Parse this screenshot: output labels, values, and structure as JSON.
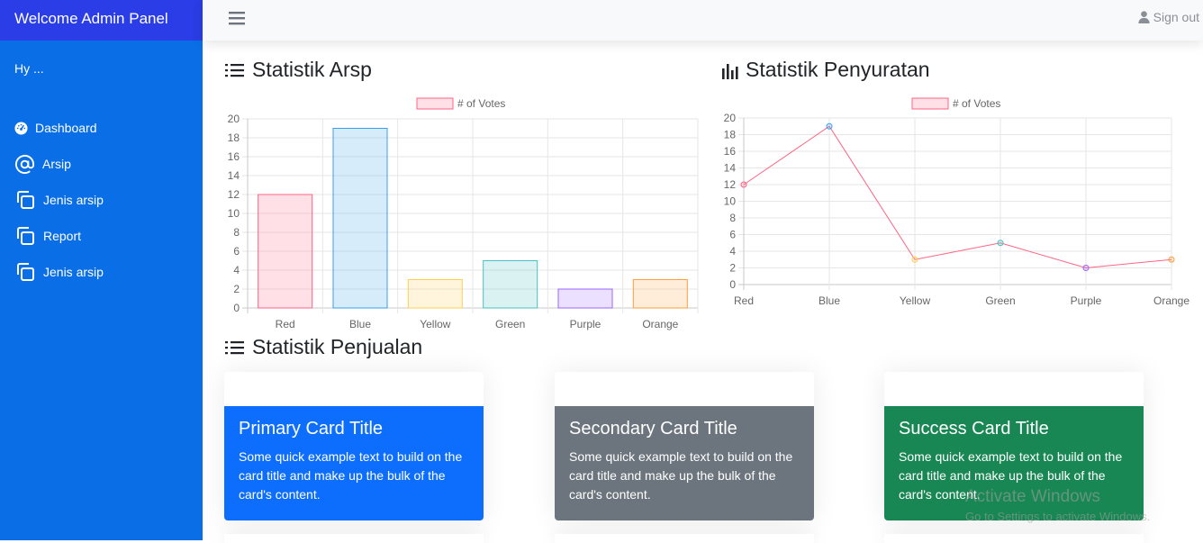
{
  "sidebar": {
    "brand": "Welcome Admin Panel",
    "greeting": "Hy ...",
    "items": [
      {
        "label": "Dashboard",
        "icon": "dashboard-icon"
      },
      {
        "label": "Arsip",
        "icon": "at-icon"
      },
      {
        "label": "Jenis arsip",
        "icon": "copy-icon"
      },
      {
        "label": "Report",
        "icon": "copy-icon"
      },
      {
        "label": "Jenis arsip",
        "icon": "copy-icon"
      }
    ]
  },
  "topbar": {
    "signout_label": "Sign out"
  },
  "sections": {
    "arsip_title": "Statistik Arsp",
    "penyuratan_title": "Statistik Penyuratan",
    "penjualan_title": "Statistik Penjualan"
  },
  "chart_data": [
    {
      "type": "bar",
      "categories": [
        "Red",
        "Blue",
        "Yellow",
        "Green",
        "Purple",
        "Orange"
      ],
      "series": [
        {
          "name": "# of Votes",
          "values": [
            12,
            19,
            3,
            5,
            2,
            3
          ]
        }
      ],
      "ylim": [
        0,
        20
      ],
      "yticks": [
        0,
        2,
        4,
        6,
        8,
        10,
        12,
        14,
        16,
        18,
        20
      ],
      "legend": "top",
      "grid": true,
      "colors": [
        "#ff6384",
        "#36a2eb",
        "#ffce56",
        "#4bc0c0",
        "#9966ff",
        "#ff9f40"
      ]
    },
    {
      "type": "line",
      "categories": [
        "Red",
        "Blue",
        "Yellow",
        "Green",
        "Purple",
        "Orange"
      ],
      "series": [
        {
          "name": "# of Votes",
          "values": [
            12,
            19,
            3,
            5,
            2,
            3
          ]
        }
      ],
      "ylim": [
        0,
        20
      ],
      "yticks": [
        0,
        2,
        4,
        6,
        8,
        10,
        12,
        14,
        16,
        18,
        20
      ],
      "legend": "top",
      "grid": true,
      "line_color": "#ff6384",
      "colors": [
        "#ff6384",
        "#36a2eb",
        "#ffce56",
        "#4bc0c0",
        "#9966ff",
        "#ff9f40"
      ]
    }
  ],
  "cards": [
    {
      "title": "Primary Card Title",
      "text": "Some quick example text to build on the card title and make up the bulk of the card's content.",
      "color": "#0d6efd"
    },
    {
      "title": "Secondary Card Title",
      "text": "Some quick example text to build on the card title and make up the bulk of the card's content.",
      "color": "#6c757d"
    },
    {
      "title": "Success Card Title",
      "text": "Some quick example text to build on the card title and make up the bulk of the card's content.",
      "color": "#198754"
    }
  ],
  "watermark": {
    "line1": "Activate Windows",
    "line2": "Go to Settings to activate Windows."
  }
}
